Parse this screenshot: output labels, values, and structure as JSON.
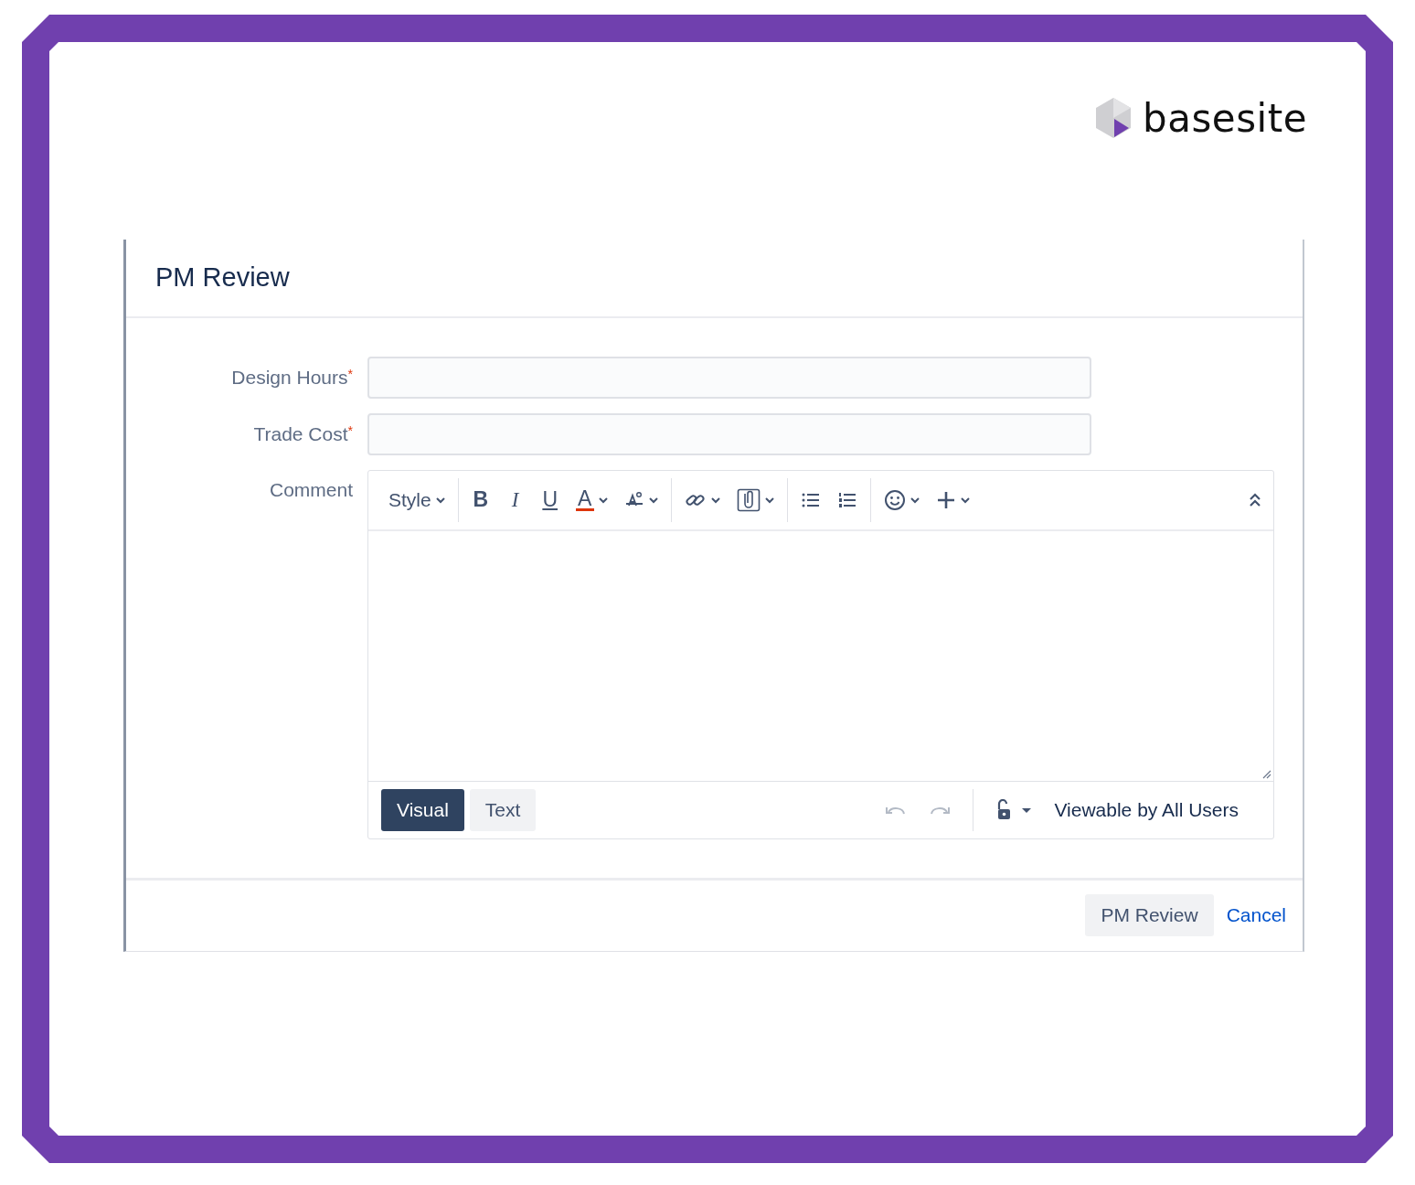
{
  "logo": {
    "text": "basesite"
  },
  "dialog": {
    "title": "PM Review",
    "fields": [
      {
        "label": "Design Hours",
        "required_mark": "*"
      },
      {
        "label": "Trade Cost",
        "required_mark": "*"
      }
    ],
    "comment": {
      "label": "Comment",
      "toolbar": [
        [
          {
            "kind": "text",
            "label": "Style",
            "caret": true
          }
        ],
        [
          {
            "kind": "bold",
            "label": "B",
            "caret": false
          },
          {
            "kind": "italic",
            "label": "I",
            "caret": false
          },
          {
            "kind": "underline",
            "label": "U",
            "caret": false
          },
          {
            "kind": "color",
            "label": "A",
            "caret": true
          },
          {
            "kind": "format",
            "caret": true
          }
        ],
        [
          {
            "kind": "link",
            "caret": true
          },
          {
            "kind": "attach",
            "caret": true
          }
        ],
        [
          {
            "kind": "bullets",
            "caret": false
          },
          {
            "kind": "numbers",
            "caret": false
          }
        ],
        [
          {
            "kind": "emoji",
            "caret": true
          },
          {
            "kind": "plus",
            "caret": true
          }
        ]
      ],
      "modes": [
        {
          "label": "Visual",
          "selected": true
        },
        {
          "label": "Text",
          "selected": false
        }
      ],
      "visibility": "Viewable by All Users"
    },
    "buttons": [
      {
        "label": "PM Review",
        "kind": "secondary"
      },
      {
        "label": "Cancel",
        "kind": "link"
      }
    ]
  }
}
